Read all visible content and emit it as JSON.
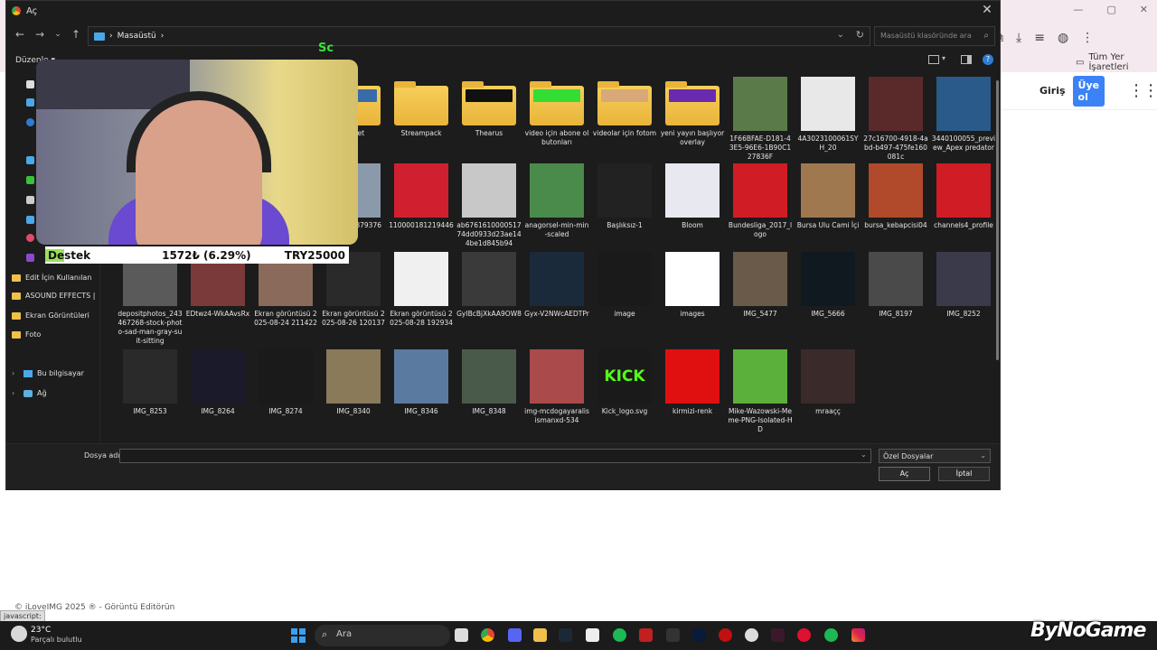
{
  "dialog": {
    "title": "Aç",
    "close_glyph": "✕",
    "breadcrumb": {
      "sep1": "›",
      "folder": "Masaüstü",
      "sep2": "›"
    },
    "search_placeholder": "Masaüstü klasöründe ara",
    "organize": "Düzenle ▾",
    "nav_pane": [
      {
        "label": "Edit İçin Kullanılan",
        "kind": "folder"
      },
      {
        "label": "ASOUND EFFECTS |",
        "kind": "folder"
      },
      {
        "label": "Ekran Görüntüleri",
        "kind": "folder"
      },
      {
        "label": "Foto",
        "kind": "folder"
      },
      {
        "label": "Bu bilgisayar",
        "kind": "pc"
      },
      {
        "label": "Ağ",
        "kind": "network"
      }
    ],
    "files": [
      {
        "name": "Samet",
        "kind": "folder",
        "peek": "#3a6aa8"
      },
      {
        "name": "Streampack",
        "kind": "folder",
        "peek": ""
      },
      {
        "name": "Thearus",
        "kind": "folder",
        "peek": "#111111"
      },
      {
        "name": "video için abone ol butonları",
        "kind": "folder",
        "peek": "#33dd33"
      },
      {
        "name": "videolar için fotom",
        "kind": "folder",
        "peek": "#d8a878"
      },
      {
        "name": "yeni yayın başlıyor overlay",
        "kind": "folder",
        "peek": "#6a2ab0"
      },
      {
        "name": "1F66BFAE-D181-43E5-96E6-1B90C127836F",
        "kind": "image",
        "color": "#5a7a4a"
      },
      {
        "name": "4A3023100061SYH_20",
        "kind": "image",
        "color": "#e8e8e8"
      },
      {
        "name": "27c16700-4918-4abd-b497-475fe160081c",
        "kind": "image",
        "color": "#5a2a2a"
      },
      {
        "name": "3440100055_preview_Apex predator",
        "kind": "image",
        "color": "#2a5a8a"
      },
      {
        "name": "1636218879376",
        "kind": "image",
        "color": "#8a9aaa"
      },
      {
        "name": "110000181219446",
        "kind": "image",
        "color": "#d02030"
      },
      {
        "name": "ab676161000051774dd0933d23ae144be1d845b94",
        "kind": "image",
        "color": "#c8c8c8"
      },
      {
        "name": "anagorsel-min-min-scaled",
        "kind": "image",
        "color": "#4a8a4a"
      },
      {
        "name": "Başlıksız-1",
        "kind": "image",
        "color": "#222222"
      },
      {
        "name": "Bloom",
        "kind": "image",
        "color": "#e8e8f0"
      },
      {
        "name": "Bundesliga_2017_logo",
        "kind": "image",
        "color": "#d01c24"
      },
      {
        "name": "Bursa Ulu Cami İçi",
        "kind": "image",
        "color": "#a07850"
      },
      {
        "name": "bursa_kebapcisi04",
        "kind": "image",
        "color": "#b04a2a"
      },
      {
        "name": "channels4_profile",
        "kind": "image",
        "color": "#d01c24"
      },
      {
        "name": "depositphotos_243467268-stock-photo-sad-man-gray-suit-sitting",
        "kind": "image",
        "color": "#5a5a5a"
      },
      {
        "name": "EDtwz4-WkAAvsRx",
        "kind": "image",
        "color": "#7a3a3a"
      },
      {
        "name": "Ekran görüntüsü 2025-08-24 211422",
        "kind": "image",
        "color": "#8a6a5a"
      },
      {
        "name": "Ekran görüntüsü 2025-08-26 120137",
        "kind": "image",
        "color": "#2a2a2a"
      },
      {
        "name": "Ekran görüntüsü 2025-08-28 192934",
        "kind": "image",
        "color": "#f0f0f0"
      },
      {
        "name": "GyIBcBjXkAA9OW8",
        "kind": "image",
        "color": "#3a3a3a"
      },
      {
        "name": "Gyx-V2NWcAEDTPr",
        "kind": "image",
        "color": "#1a2a3a"
      },
      {
        "name": "image",
        "kind": "image",
        "color": "#1a1a1a"
      },
      {
        "name": "images",
        "kind": "image",
        "color": "#ffffff"
      },
      {
        "name": "IMG_5477",
        "kind": "image",
        "color": "#6a5a4a"
      },
      {
        "name": "IMG_5666",
        "kind": "image",
        "color": "#101820"
      },
      {
        "name": "IMG_8197",
        "kind": "image",
        "color": "#4a4a4a"
      },
      {
        "name": "IMG_8252",
        "kind": "image",
        "color": "#3a3a4a"
      },
      {
        "name": "IMG_8253",
        "kind": "image",
        "color": "#2a2a2a"
      },
      {
        "name": "IMG_8264",
        "kind": "image",
        "color": "#1a1a2a"
      },
      {
        "name": "IMG_8274",
        "kind": "image",
        "color": "#1a1a1a"
      },
      {
        "name": "IMG_8340",
        "kind": "image",
        "color": "#8a7a5a"
      },
      {
        "name": "IMG_8346",
        "kind": "image",
        "color": "#5a7aa0"
      },
      {
        "name": "IMG_8348",
        "kind": "image",
        "color": "#4a5a4a"
      },
      {
        "name": "img-mcdogayaralisismanxd-534",
        "kind": "image",
        "color": "#aa4a4a"
      },
      {
        "name": "Kick_logo.svg",
        "kind": "image",
        "color": "#1a1a1a",
        "text": "KICK"
      },
      {
        "name": "kirmizi-renk",
        "kind": "image",
        "color": "#e01010"
      },
      {
        "name": "Mike-Wazowski-Meme-PNG-Isolated-HD",
        "kind": "image",
        "color": "#5ab03a"
      },
      {
        "name": "mraaçç",
        "kind": "image",
        "color": "#3a2a2a"
      }
    ],
    "filename_label": "Dosya adı:",
    "filename_value": "",
    "filter": "Özel Dosyalar",
    "open_label": "Aç",
    "cancel_label": "İptal"
  },
  "overlay": {
    "sc_badge": "Sc",
    "donation_label": "Destek",
    "donation_progress": "1572₺ (6.29%)",
    "donation_goal": "TRY25000"
  },
  "browser": {
    "bookmarks_label": "Tüm Yer İşaretleri",
    "login": "Giriş",
    "signup": "Üye ol",
    "footer": "© iLoveIMG 2025 ® - Görüntü Editörün",
    "status_url": "javascript:"
  },
  "taskbar": {
    "temperature": "23°C",
    "weather": "Parçalı bulutlu",
    "search_placeholder": "Ara",
    "watermark": "ByNoGame"
  }
}
